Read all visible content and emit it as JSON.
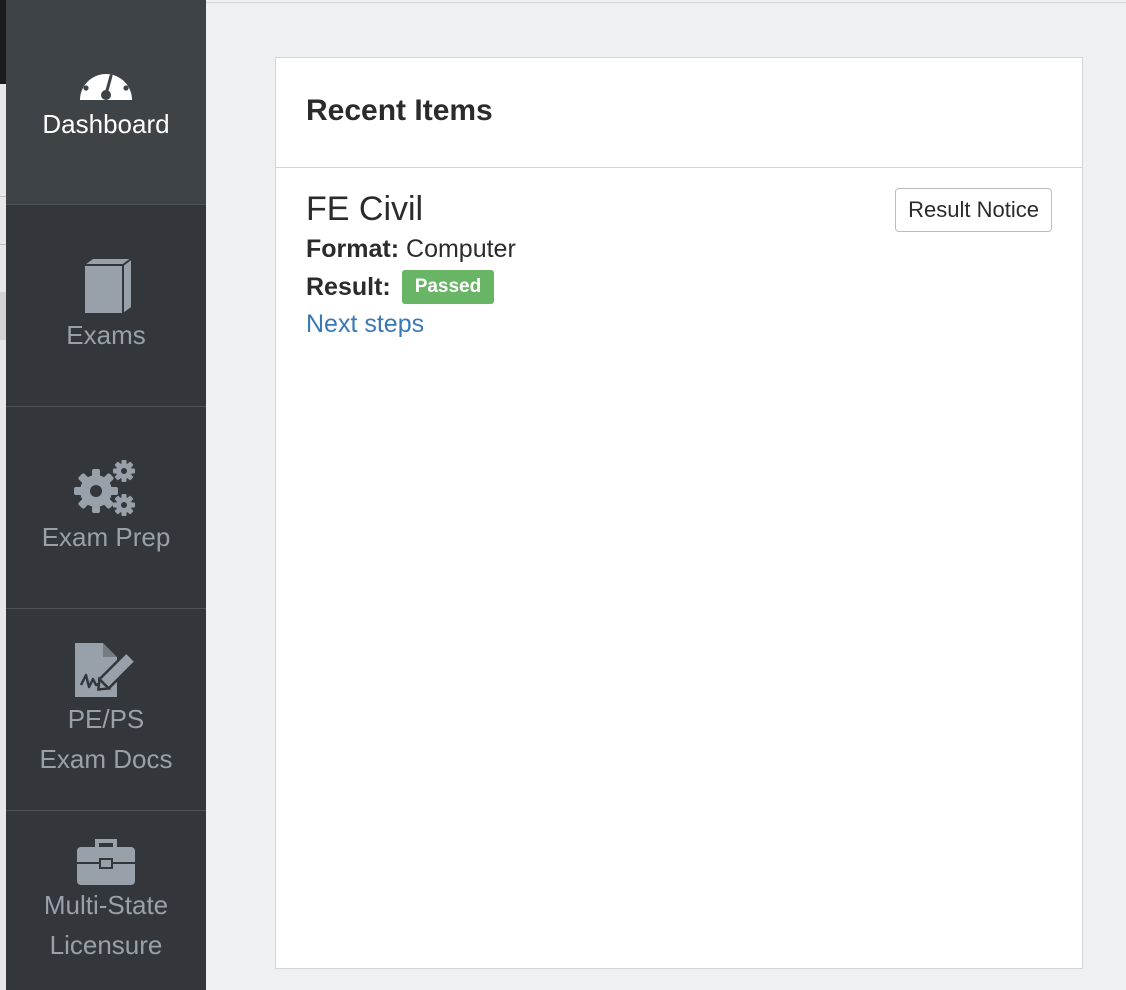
{
  "sidebar": {
    "accent_color": "#e0483a",
    "items": [
      {
        "label": "Dashboard",
        "icon": "dashboard-gauge-icon",
        "active": true
      },
      {
        "label": "Exams",
        "icon": "book-icon",
        "active": false
      },
      {
        "label": "Exam Prep",
        "icon": "gears-icon",
        "active": false
      },
      {
        "label": "PE/PS\nExam Docs",
        "icon": "signed-document-icon",
        "active": false
      },
      {
        "label": "Multi-State\nLicensure",
        "icon": "briefcase-icon",
        "active": false
      }
    ]
  },
  "recent": {
    "title": "Recent Items",
    "item": {
      "name": "FE Civil",
      "format_label": "Format:",
      "format_value": "Computer",
      "result_label": "Result:",
      "result_value": "Passed",
      "result_color": "#68b665",
      "link_label": "Next steps",
      "button_label": "Result Notice"
    }
  }
}
